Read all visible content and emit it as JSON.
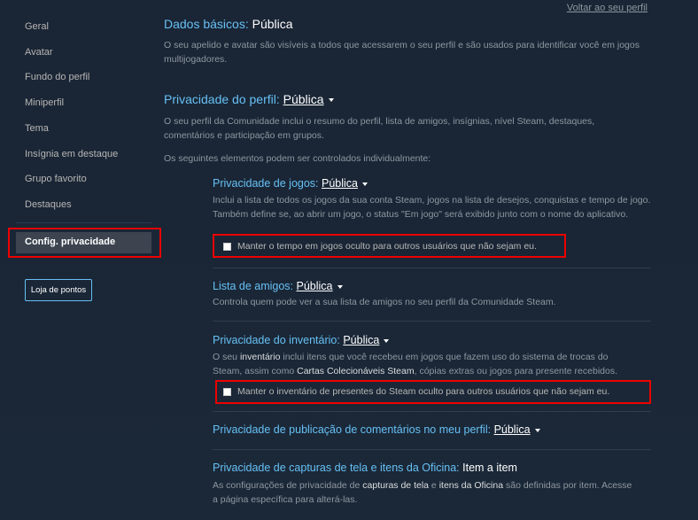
{
  "sidebar": {
    "items": [
      "Geral",
      "Avatar",
      "Fundo do perfil",
      "Miniperfil",
      "Tema",
      "Insígnia em destaque",
      "Grupo favorito",
      "Destaques"
    ],
    "active": "Config. privacidade",
    "shop_button": "Loja de pontos"
  },
  "back_link": "Voltar ao seu perfil",
  "basic": {
    "label": "Dados básicos:",
    "value": "Pública",
    "desc": "O seu apelido e avatar são visíveis a todos que acessarem o seu perfil e são usados para identificar você em jogos multijogadores."
  },
  "profile": {
    "label": "Privacidade do perfil:",
    "value": "Pública",
    "desc": "O seu perfil da Comunidade inclui o resumo do perfil, lista de amigos, insígnias, nível Steam, destaques, comentários e participação em grupos.",
    "note": "Os seguintes elementos podem ser controlados individualmente:"
  },
  "games": {
    "label": "Privacidade de jogos:",
    "value": "Pública",
    "desc": "Inclui a lista de todos os jogos da sua conta Steam, jogos na lista de desejos, conquistas e tempo de jogo. Também define se, ao abrir um jogo, o status \"Em jogo\" será exibido junto com o nome do aplicativo.",
    "checkbox": "Manter o tempo em jogos oculto para outros usuários que não sejam eu."
  },
  "friends": {
    "label": "Lista de amigos:",
    "value": "Pública",
    "desc": "Controla quem pode ver a sua lista de amigos no seu perfil da Comunidade Steam."
  },
  "inventory": {
    "label": "Privacidade do inventário:",
    "value": "Pública",
    "desc_1": "O seu ",
    "desc_bold_1": "inventário",
    "desc_2": " inclui itens que você recebeu em jogos que fazem uso do sistema de trocas do Steam, assim como ",
    "desc_bold_2": "Cartas Colecionáveis Steam",
    "desc_3": ", cópias extras ou jogos para presente recebidos.",
    "checkbox": "Manter o inventário de presentes do Steam oculto para outros usuários que não sejam eu."
  },
  "comments": {
    "label": "Privacidade de publicação de comentários no meu perfil:",
    "value": "Pública"
  },
  "screenshots": {
    "label": "Privacidade de capturas de tela e itens da Oficina:",
    "value": "Item a item",
    "desc_1": "As configurações de privacidade de ",
    "desc_bold_1": "capturas de tela",
    "desc_2": " e ",
    "desc_bold_2": "itens da Oficina",
    "desc_3": " são definidas por item. Acesse a página específica para alterá-las."
  }
}
